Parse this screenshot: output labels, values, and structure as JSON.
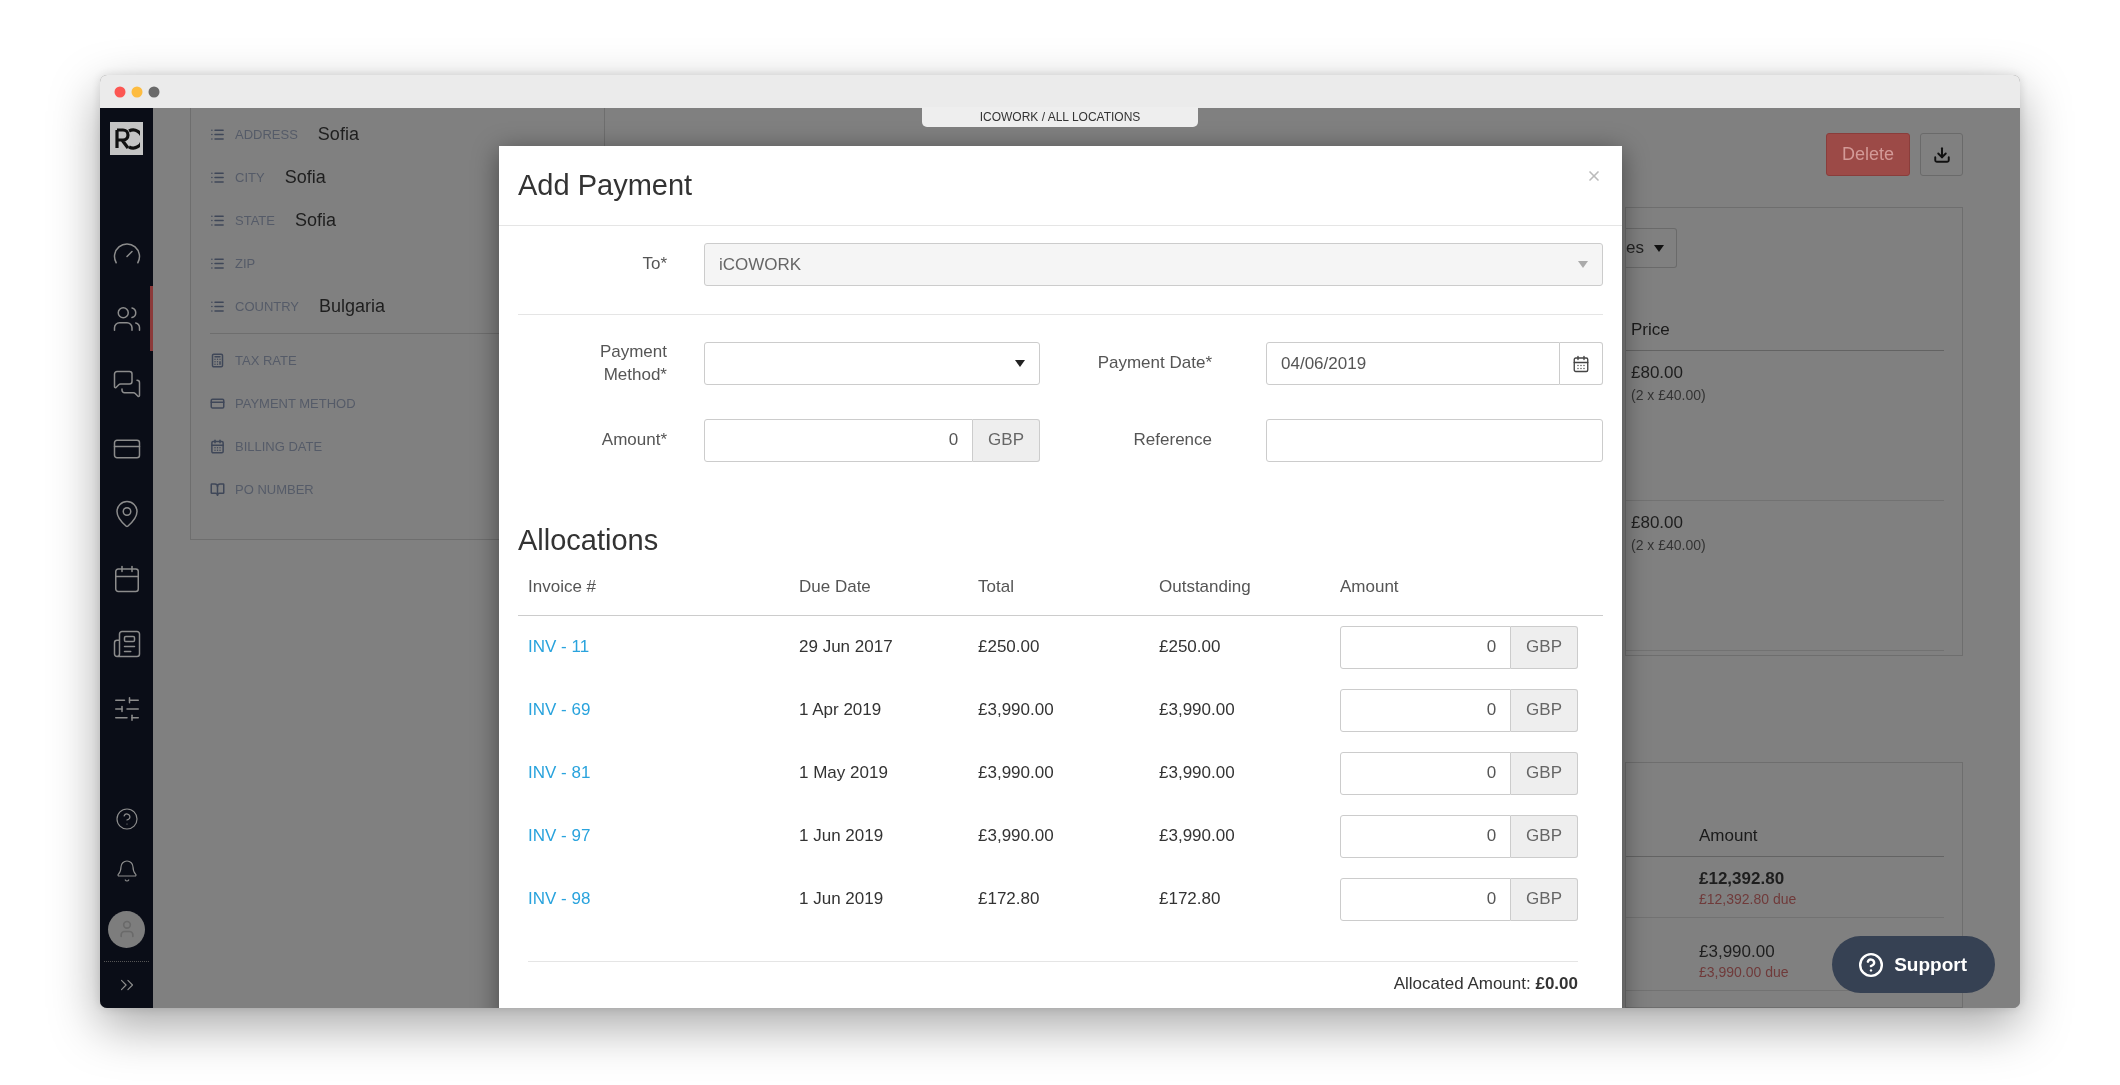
{
  "breadcrumb": "ICOWORK / ALL LOCATIONS",
  "sidebar": {
    "items": [
      {
        "selected": false
      },
      {
        "selected": true
      },
      {
        "selected": false
      },
      {
        "selected": false
      },
      {
        "selected": false
      },
      {
        "selected": false
      },
      {
        "selected": false
      },
      {
        "selected": false
      }
    ]
  },
  "details": {
    "sections": [
      {
        "fields": [
          {
            "label": "ADDRESS",
            "value": "Sofia"
          },
          {
            "label": "CITY",
            "value": "Sofia"
          },
          {
            "label": "STATE",
            "value": "Sofia"
          },
          {
            "label": "ZIP"
          },
          {
            "label": "COUNTRY",
            "value": "Bulgaria"
          }
        ]
      },
      {
        "fields": [
          {
            "label": "TAX RATE"
          },
          {
            "label": "PAYMENT METHOD"
          },
          {
            "label": "BILLING DATE"
          },
          {
            "label": "PO NUMBER"
          }
        ]
      }
    ]
  },
  "toolbar": {
    "delete": "Delete"
  },
  "lines_card": {
    "filter": "es",
    "header": "Price",
    "rows": [
      {
        "price": "£80.00",
        "detail": "(2 x £40.00)"
      },
      {
        "price": "£80.00",
        "detail": "(2 x £40.00)"
      }
    ]
  },
  "invoices_card": {
    "header": "Amount",
    "rows": [
      {
        "amount": "£12,392.80",
        "due": "£12,392.80 due",
        "emphasized": true
      },
      {
        "amount": "£3,990.00",
        "due": "£3,990.00 due",
        "emphasized": false
      }
    ]
  },
  "support": "Support",
  "modal": {
    "title": "Add Payment",
    "to": {
      "label": "To*",
      "value": "iCOWORK",
      "disabled": true
    },
    "payment_method": {
      "label": "Payment Method*"
    },
    "payment_date": {
      "label": "Payment Date*",
      "value": "04/06/2019"
    },
    "amount": {
      "label": "Amount*",
      "value": "0",
      "currency": "GBP"
    },
    "reference": {
      "label": "Reference"
    },
    "allocations": {
      "title": "Allocations",
      "columns": [
        "Invoice #",
        "Due Date",
        "Total",
        "Outstanding",
        "Amount"
      ],
      "rows": [
        {
          "invoice": "INV - 11",
          "due_date": "29 Jun 2017",
          "total": "£250.00",
          "outstanding": "£250.00",
          "amount": "0",
          "currency": "GBP"
        },
        {
          "invoice": "INV - 69",
          "due_date": "1 Apr 2019",
          "total": "£3,990.00",
          "outstanding": "£3,990.00",
          "amount": "0",
          "currency": "GBP"
        },
        {
          "invoice": "INV - 81",
          "due_date": "1 May 2019",
          "total": "£3,990.00",
          "outstanding": "£3,990.00",
          "amount": "0",
          "currency": "GBP"
        },
        {
          "invoice": "INV - 97",
          "due_date": "1 Jun 2019",
          "total": "£3,990.00",
          "outstanding": "£3,990.00",
          "amount": "0",
          "currency": "GBP"
        },
        {
          "invoice": "INV - 98",
          "due_date": "1 Jun 2019",
          "total": "£172.80",
          "outstanding": "£172.80",
          "amount": "0",
          "currency": "GBP"
        }
      ]
    },
    "allocated": {
      "label": "Allocated Amount:",
      "value": "£0.00"
    }
  }
}
